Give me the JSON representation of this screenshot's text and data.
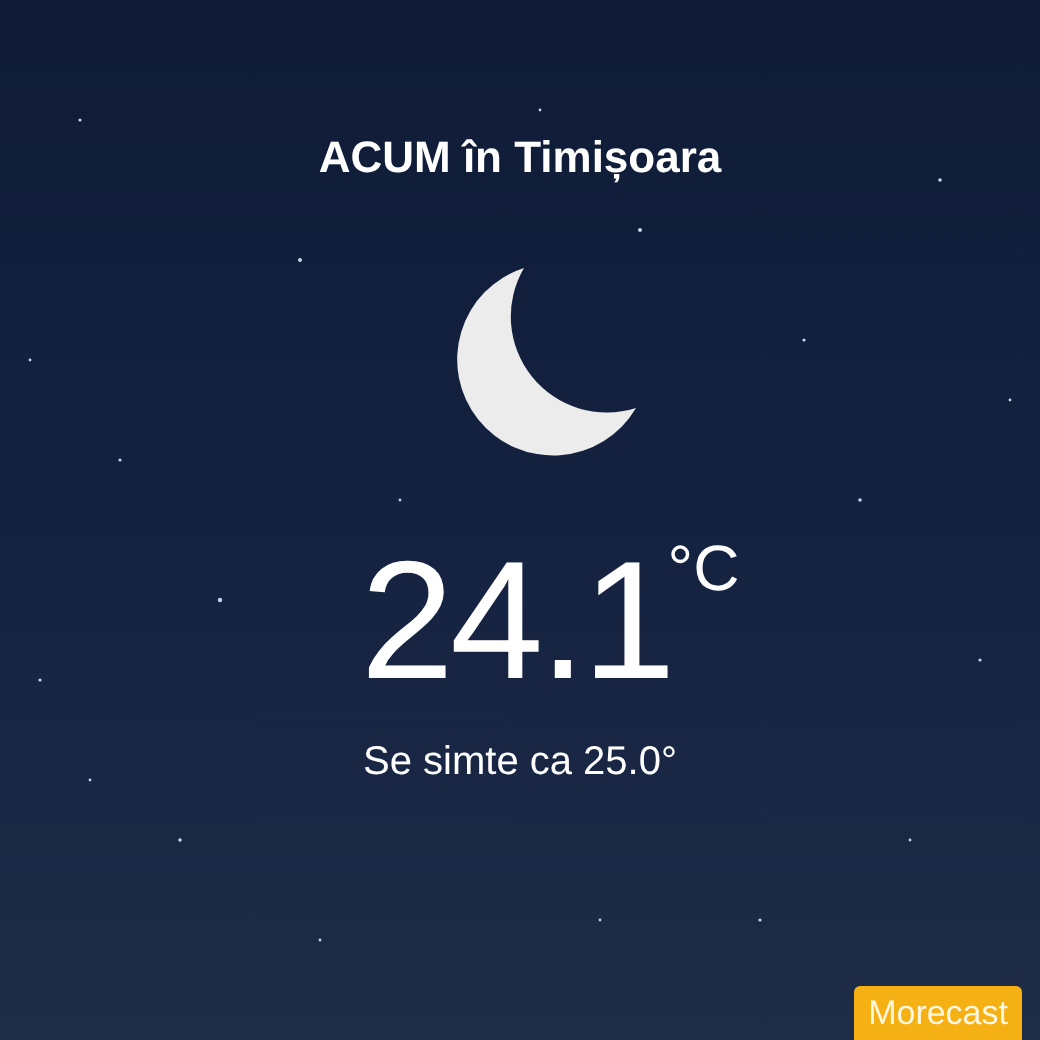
{
  "title": "ACUM în Timișoara",
  "temperature": "24.1",
  "unit": "°C",
  "feels_like": "Se simte ca 25.0°",
  "brand": "Morecast"
}
